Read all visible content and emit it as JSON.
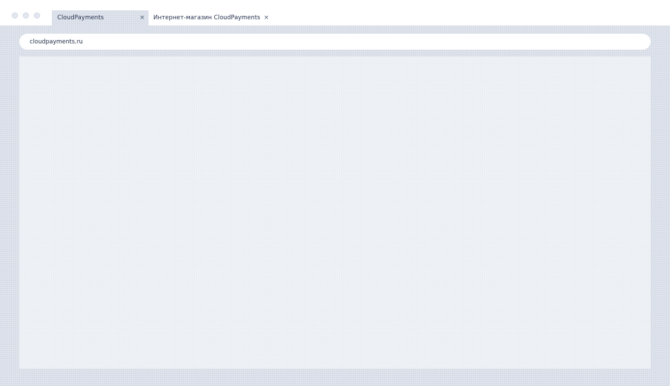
{
  "tabs": [
    {
      "label": "CloudPayments",
      "close_label": "×",
      "active": true
    },
    {
      "label": "Интернет-магазин CloudPayments",
      "close_label": "×",
      "active": false
    }
  ],
  "address_bar": {
    "url": "cloudpayments.ru"
  },
  "colors": {
    "chrome_background": "#dde2eb",
    "titlebar": "#ffffff",
    "content_background": "#eef1f5",
    "text": "#1e2a44"
  }
}
